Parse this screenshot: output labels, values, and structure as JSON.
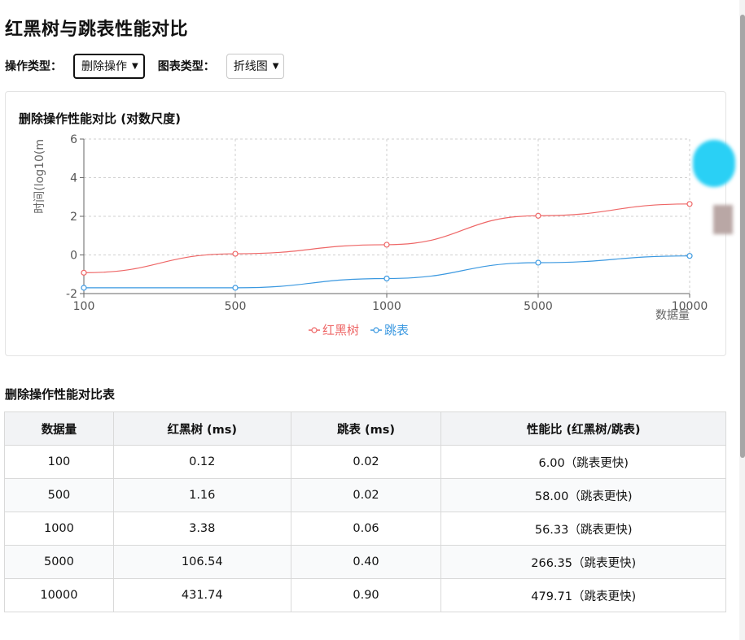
{
  "page": {
    "title": "红黑树与跳表性能对比"
  },
  "controls": {
    "operation_label": "操作类型：",
    "operation_value": "删除操作",
    "chart_type_label": "图表类型：",
    "chart_type_value": "折线图"
  },
  "chart_data": {
    "type": "line",
    "title": "删除操作性能对比 (对数尺度)",
    "xlabel": "数据量",
    "ylabel": "时间(log10(m",
    "categories": [
      "100",
      "500",
      "1000",
      "5000",
      "10000"
    ],
    "y_ticks": [
      "6",
      "4",
      "2",
      "0",
      "-2"
    ],
    "ylim": [
      -2,
      6
    ],
    "grid": true,
    "legend_position": "bottom-center",
    "series": [
      {
        "name": "红黑树",
        "color": "#ee6666",
        "values": [
          -0.92,
          0.06,
          0.53,
          2.03,
          2.64
        ]
      },
      {
        "name": "跳表",
        "color": "#3a98e0",
        "values": [
          -1.7,
          -1.7,
          -1.22,
          -0.4,
          -0.05
        ]
      }
    ]
  },
  "table": {
    "title": "删除操作性能对比表",
    "headers": [
      "数据量",
      "红黑树 (ms)",
      "跳表 (ms)",
      "性能比 (红黑树/跳表)"
    ],
    "rows": [
      [
        "100",
        "0.12",
        "0.02",
        "6.00（跳表更快)"
      ],
      [
        "500",
        "1.16",
        "0.02",
        "58.00（跳表更快)"
      ],
      [
        "1000",
        "3.38",
        "0.06",
        "56.33（跳表更快)"
      ],
      [
        "5000",
        "106.54",
        "0.40",
        "266.35（跳表更快)"
      ],
      [
        "10000",
        "431.74",
        "0.90",
        "479.71（跳表更快)"
      ]
    ]
  }
}
